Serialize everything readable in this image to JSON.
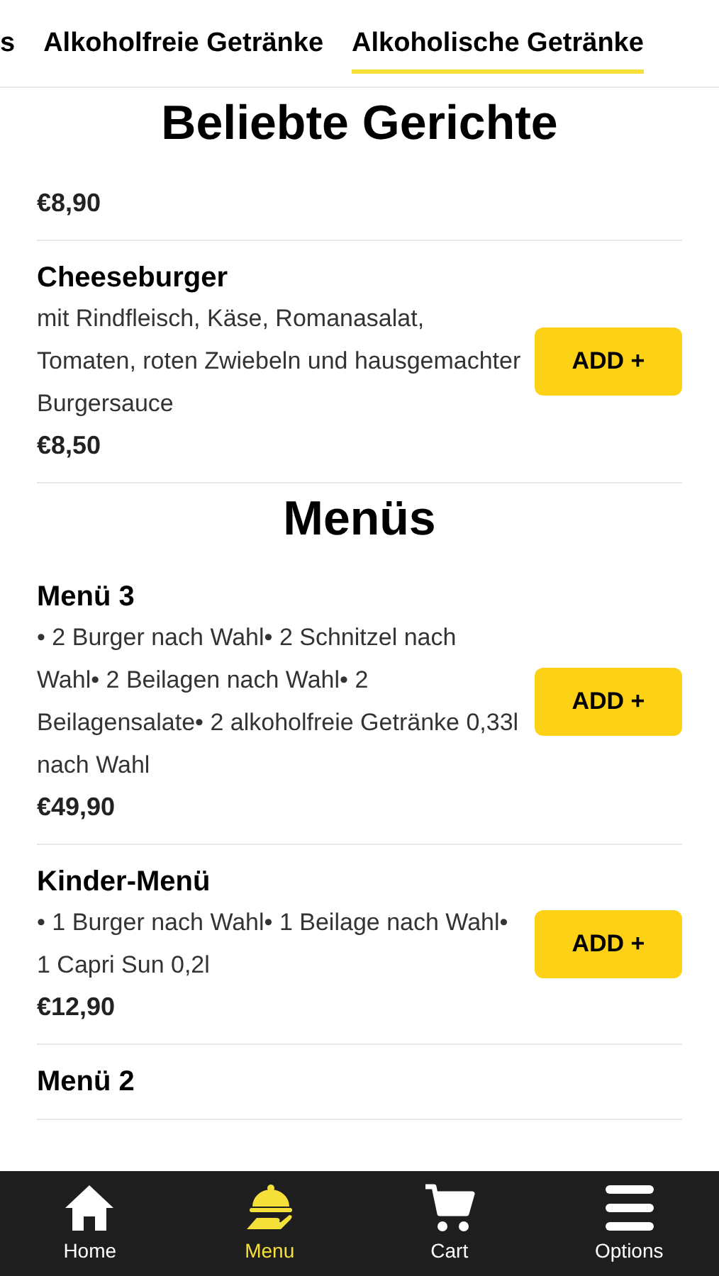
{
  "tabs": [
    {
      "label": "s",
      "selected": false
    },
    {
      "label": "Alkoholfreie Getränke",
      "selected": false
    },
    {
      "label": "Alkoholische Getränke",
      "selected": true
    }
  ],
  "sections": [
    {
      "title": "Beliebte Gerichte",
      "items": [
        {
          "price": "€8,90"
        },
        {
          "name": "Cheeseburger",
          "description": "mit Rindfleisch, Käse, Romanasalat, Tomaten, roten Zwiebeln und hausgemachter Burgersauce",
          "price": "€8,50",
          "button": "ADD +"
        }
      ]
    },
    {
      "title": "Menüs",
      "items": [
        {
          "name": "Menü 3",
          "description": "• 2 Burger nach Wahl• 2 Schnitzel nach Wahl• 2 Beilagen nach Wahl• 2 Beilagensalate• 2 alkoholfreie Getränke 0,33l nach Wahl",
          "price": "€49,90",
          "button": "ADD +"
        },
        {
          "name": "Kinder-Menü",
          "description": "• 1 Burger nach Wahl• 1 Beilage nach Wahl• 1 Capri Sun 0,2l",
          "price": "€12,90",
          "button": "ADD +"
        },
        {
          "name": "Menü 2"
        }
      ]
    }
  ],
  "nav": [
    {
      "label": "Home",
      "kind": "home",
      "selected": false
    },
    {
      "label": "Menu",
      "kind": "menu",
      "selected": true
    },
    {
      "label": "Cart",
      "kind": "cart",
      "selected": false
    },
    {
      "label": "Options",
      "kind": "options",
      "selected": false
    }
  ]
}
